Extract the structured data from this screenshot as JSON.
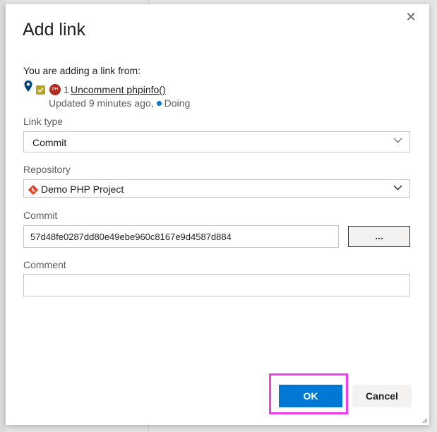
{
  "dialog": {
    "title": "Add link",
    "close_symbol": "✕"
  },
  "source": {
    "label": "You are adding a link from:",
    "work_item": {
      "avatar_initials": "PH",
      "id": "1",
      "title": "Uncomment phpinfo()",
      "updated": "Updated 9 minutes ago,",
      "state": "Doing",
      "state_color": "#0078d4",
      "type_color": "#b8a31c"
    }
  },
  "link_type": {
    "label": "Link type",
    "value": "Commit"
  },
  "repository": {
    "label": "Repository",
    "value": "Demo PHP Project",
    "icon": "git-repo-icon",
    "icon_color": "#e24329"
  },
  "commit": {
    "label": "Commit",
    "value": "57d48fe0287dd80e49ebe960c8167e9d4587d884",
    "browse_label": "..."
  },
  "comment": {
    "label": "Comment",
    "value": ""
  },
  "actions": {
    "ok_label": "OK",
    "cancel_label": "Cancel",
    "accent": "#0078d4",
    "highlight_color": "#f23cf0"
  }
}
